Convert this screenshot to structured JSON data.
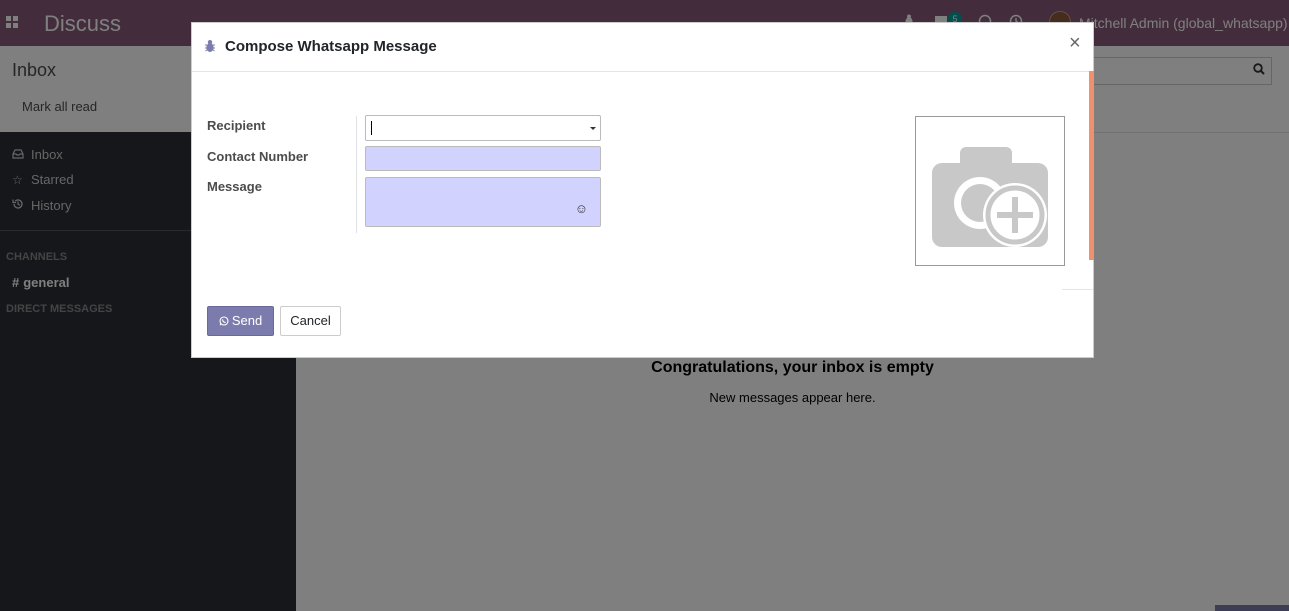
{
  "topbar": {
    "app_title": "Discuss",
    "notification_count": "5",
    "user_name": "Mitchell Admin (global_whatsapp)"
  },
  "control": {
    "breadcrumb": "Inbox",
    "mark_all_read": "Mark all read"
  },
  "sidebar": {
    "items": [
      {
        "label": "Inbox",
        "icon": "inbox-icon"
      },
      {
        "label": "Starred",
        "icon": "star-icon"
      },
      {
        "label": "History",
        "icon": "history-icon"
      }
    ],
    "channels_header": "CHANNELS",
    "channel_general": "general",
    "direct_messages_header": "DIRECT MESSAGES"
  },
  "main": {
    "empty_title": "Congratulations, your inbox is empty",
    "empty_subtitle": "New messages appear here."
  },
  "modal": {
    "title": "Compose Whatsapp Message",
    "close_glyph": "×",
    "fields": {
      "recipient_label": "Recipient",
      "recipient_value": "",
      "contact_label": "Contact Number",
      "contact_value": "",
      "message_label": "Message",
      "message_value": ""
    },
    "send_label": "Send",
    "cancel_label": "Cancel"
  },
  "colors": {
    "brand": "#875a7b",
    "primary_button": "#7c7bad",
    "required_field": "#d2d2ff",
    "scroll_accent": "#f0916d"
  }
}
